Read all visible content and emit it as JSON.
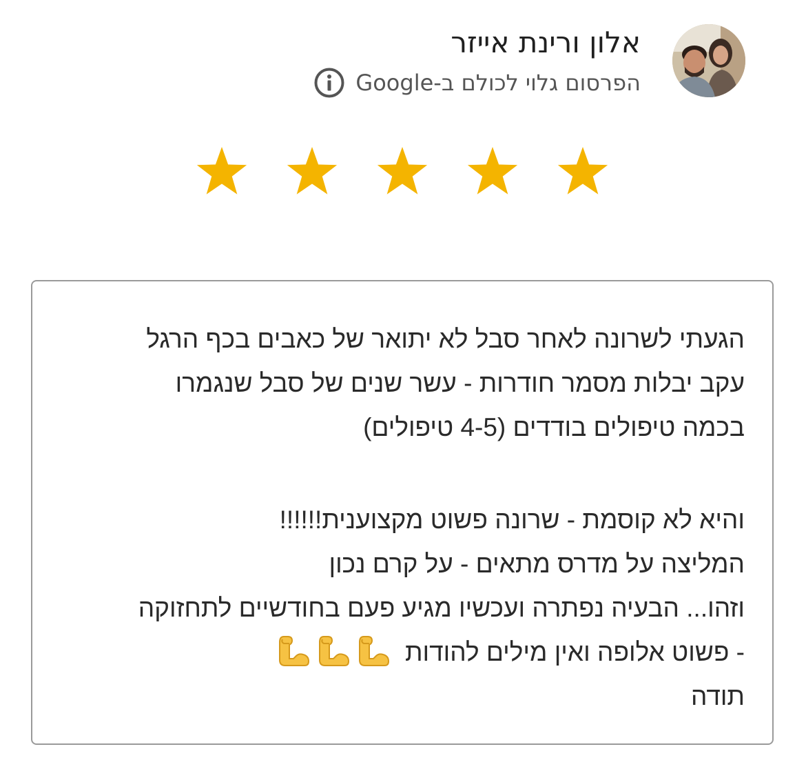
{
  "review": {
    "author_name": "אלון ורינת אייזר",
    "publicity_note": "הפרסום גלוי לכולם ב-Google",
    "info_icon": "info-circle-icon",
    "avatar_icon": "user-photo-avatar",
    "rating": 5,
    "rating_max": 5,
    "star_color": "#F4B400",
    "star_icon": "star-icon",
    "text_lines": [
      "הגעתי לשרונה לאחר סבל לא יתואר של כאבים בכף הרגל",
      "עקב יבלות מסמר חודרות - עשר שנים של סבל שנגמרו",
      "בכמה טיפולים בודדים (4-5 טיפולים)",
      "",
      "והיא לא קוסמת - שרונה פשוט מקצוענית!!!!!!",
      "המליצה על מדרס מתאים - על קרם נכון",
      "וזהו... הבעיה נפתרה ועכשיו מגיע פעם בחודשיים לתחזוקה",
      "- פשוט אלופה ואין מילים להודות",
      "תודה"
    ],
    "emoji": {
      "icon": "flexed-biceps-icon",
      "count": 3,
      "color": "#F6C243"
    },
    "border_color": "#9A9A9A"
  }
}
